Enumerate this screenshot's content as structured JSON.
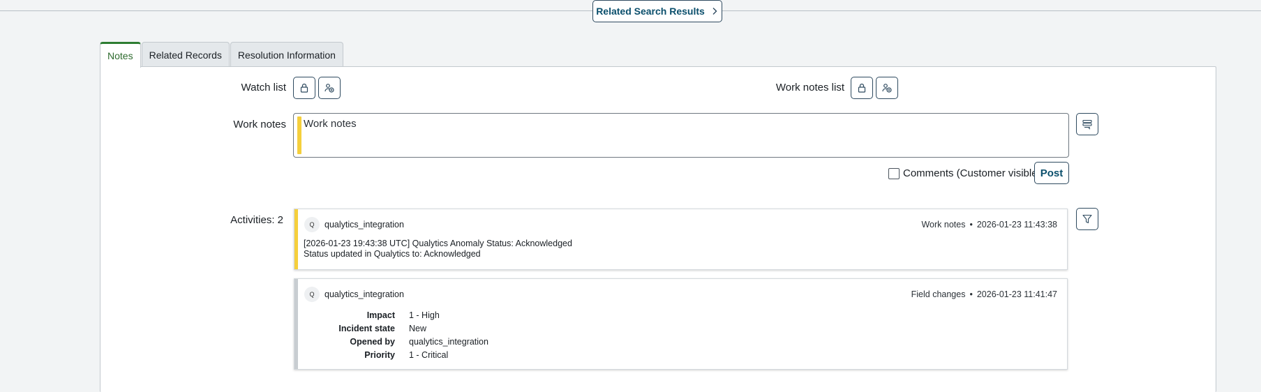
{
  "header": {
    "related_search_label": "Related Search Results"
  },
  "tabs": [
    {
      "label": "Notes",
      "active": true
    },
    {
      "label": "Related Records",
      "active": false
    },
    {
      "label": "Resolution Information",
      "active": false
    }
  ],
  "watch_list": {
    "label": "Watch list",
    "icons": [
      "lock-icon",
      "add-user-icon"
    ]
  },
  "work_notes_list": {
    "label": "Work notes list",
    "icons": [
      "lock-icon",
      "add-user-icon"
    ]
  },
  "work_notes": {
    "label": "Work notes",
    "placeholder": "Work notes",
    "value": ""
  },
  "comments_checkbox": {
    "label": "Comments (Customer visible)",
    "checked": false
  },
  "post_label": "Post",
  "activities": {
    "label": "Activities: 2",
    "items": [
      {
        "avatar": "Q",
        "author": "qualytics_integration",
        "type": "Work notes",
        "timestamp": "2026-01-23 11:43:38",
        "lines": [
          "[2026-01-23 19:43:38 UTC] Qualytics Anomaly Status: Acknowledged",
          "Status updated in Qualytics to: Acknowledged"
        ]
      },
      {
        "avatar": "Q",
        "author": "qualytics_integration",
        "type": "Field changes",
        "timestamp": "2026-01-23 11:41:47",
        "fields": [
          {
            "name": "Impact",
            "value": "1 - High"
          },
          {
            "name": "Incident state",
            "value": "New"
          },
          {
            "name": "Opened by",
            "value": "qualytics_integration"
          },
          {
            "name": "Priority",
            "value": "1 - Critical"
          }
        ]
      }
    ]
  },
  "colors": {
    "accent": "#0b4f6c",
    "active_tab": "#2e7d32",
    "work_notes_bar": "#f5cf3c",
    "field_changes_bar": "#c8cdd1"
  }
}
